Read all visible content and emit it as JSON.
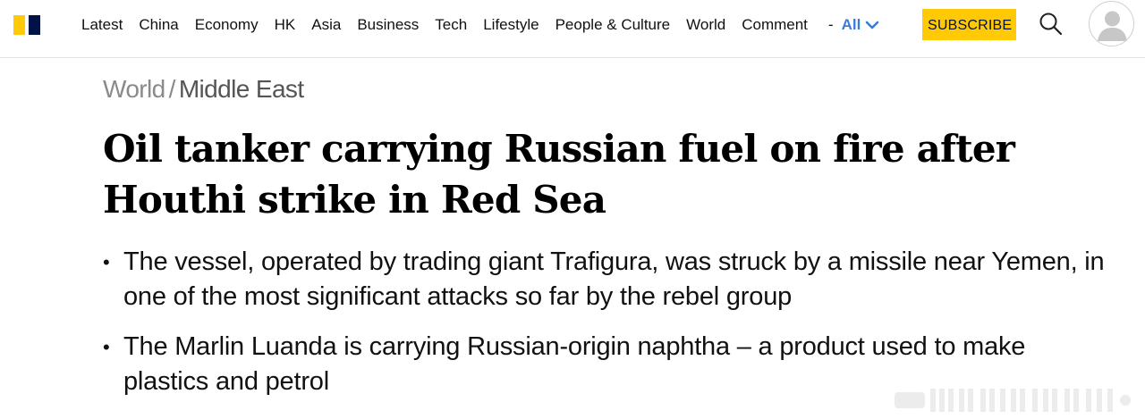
{
  "header": {
    "nav_items": [
      "Latest",
      "China",
      "Economy",
      "HK",
      "Asia",
      "Business",
      "Tech",
      "Lifestyle",
      "People & Culture",
      "World",
      "Comment"
    ],
    "separator": "-",
    "all_label": "All",
    "subscribe_label": "SUBSCRIBE"
  },
  "article": {
    "breadcrumb": {
      "section": "World",
      "separator": "/",
      "subsection": "Middle East"
    },
    "headline": "Oil tanker carrying Russian fuel on fire after Houthi strike in Red Sea",
    "bullets": [
      "The vessel, operated by trading giant Trafigura, was struck by a missile near Yemen, in one of the most significant attacks so far by the rebel group",
      "The Marlin Luanda is carrying Russian-origin naphtha – a product used to make plastics and petrol"
    ],
    "bullet_marker": "•"
  },
  "colors": {
    "logo_yellow": "#ffca05",
    "logo_navy": "#001246",
    "accent_blue": "#3d7bd9",
    "subscribe_bg": "#ffca05"
  },
  "icons": {
    "search": "search-icon",
    "chevron": "chevron-down-icon",
    "avatar": "user-avatar-icon"
  }
}
